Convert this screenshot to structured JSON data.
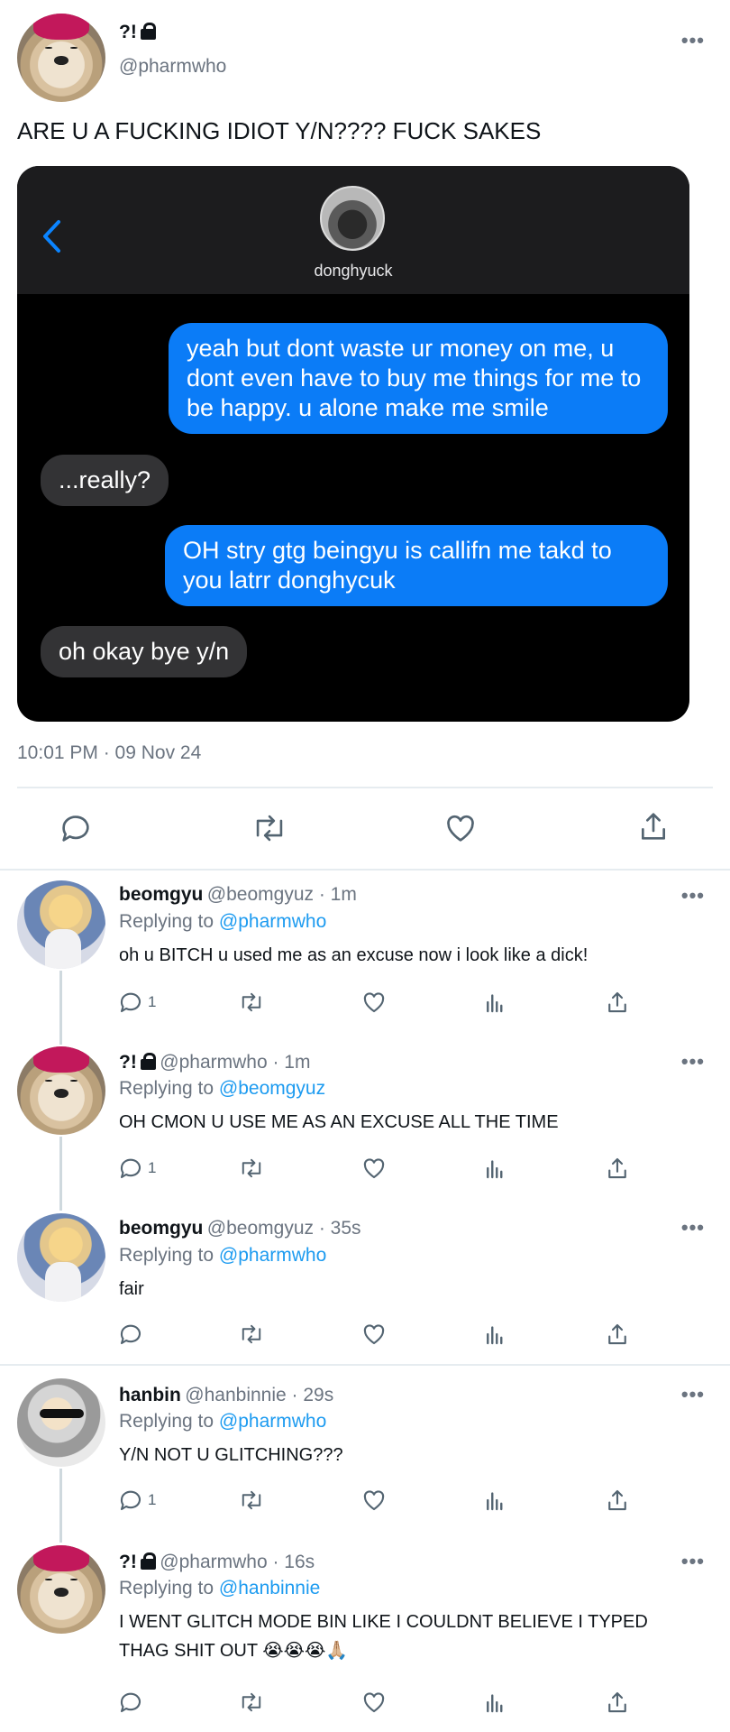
{
  "main_tweet": {
    "name": "?!",
    "handle": "@pharmwho",
    "text": "ARE U A FUCKING IDIOT Y/N???? FUCK SAKES",
    "more": "•••",
    "timestamp": "10:01 PM · 09 Nov 24",
    "embedded_dm": {
      "contact_name": "donghyuck",
      "messages": [
        {
          "from": "me",
          "text": "yeah but dont waste ur money on me, u dont even have to buy me things for me to be happy. u alone make me smile"
        },
        {
          "from": "them",
          "text": "...really?"
        },
        {
          "from": "me",
          "text": "OH stry gtg beingyu is callifn me takd to you latrr donghycuk"
        },
        {
          "from": "them",
          "text": "oh okay bye y/n"
        }
      ]
    }
  },
  "replies": [
    {
      "name": "beomgyu",
      "handle": "@beomgyuz · 1m",
      "replying_prefix": "Replying to",
      "replying_to": "@pharmwho",
      "text": "oh u BITCH u used me as an excuse now i look like a dick!",
      "reply_count": "1"
    },
    {
      "name": "?!",
      "handle": "@pharmwho · 1m",
      "replying_prefix": "Replying to",
      "replying_to": "@beomgyuz",
      "text": "OH CMON U USE ME AS AN EXCUSE ALL THE TIME",
      "reply_count": "1"
    },
    {
      "name": "beomgyu",
      "handle": "@beomgyuz · 35s",
      "replying_prefix": "Replying to",
      "replying_to": "@pharmwho",
      "text": "fair",
      "reply_count": ""
    },
    {
      "name": "hanbin",
      "handle": "@hanbinnie · 29s",
      "replying_prefix": "Replying to",
      "replying_to": "@pharmwho",
      "text": "Y/N NOT U GLITCHING???",
      "reply_count": "1"
    },
    {
      "name": "?!",
      "handle": "@pharmwho · 16s",
      "replying_prefix": "Replying to",
      "replying_to": "@hanbinnie",
      "text": "I WENT GLITCH MODE BIN LIKE I COULDNT BELIEVE I TYPED THAG SHIT OUT 😭😭😭🙏🏼",
      "reply_count": ""
    }
  ],
  "icons": {
    "reply": "reply-icon",
    "retweet": "retweet-icon",
    "like": "heart-icon",
    "views": "analytics-icon",
    "share": "share-icon",
    "lock": "lock-icon",
    "back": "chevron-left-icon"
  },
  "colors": {
    "accent": "#1d9bf0",
    "imessage_blue": "#0b7cf7",
    "muted": "#6b7480"
  }
}
